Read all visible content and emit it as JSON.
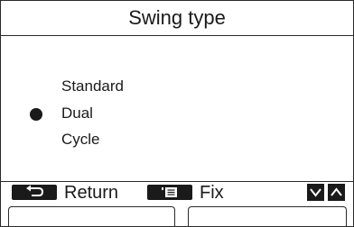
{
  "title": "Swing type",
  "options": [
    {
      "label": "Standard",
      "selected": false
    },
    {
      "label": "Dual",
      "selected": true
    },
    {
      "label": "Cycle",
      "selected": false
    }
  ],
  "keybar": {
    "return_label": "Return",
    "fix_label": "Fix",
    "return_icon": "return-arrow-icon",
    "fix_icon": "menu-list-icon",
    "down_icon": "chevron-down-icon",
    "up_icon": "chevron-up-icon"
  }
}
